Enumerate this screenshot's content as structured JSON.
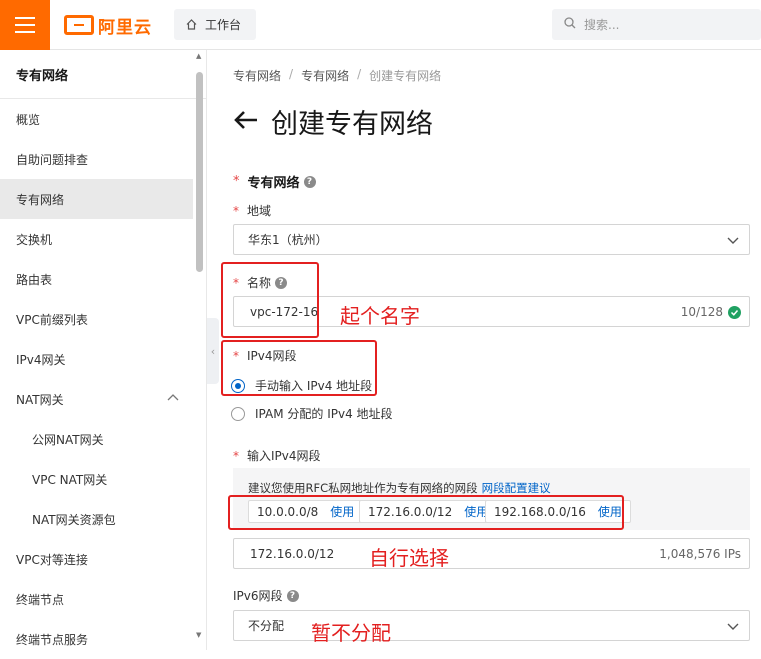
{
  "topbar": {
    "logo_text": "阿里云",
    "workbench_label": "工作台",
    "search_placeholder": "搜索..."
  },
  "sidebar": {
    "title": "专有网络",
    "items": [
      {
        "label": "概览"
      },
      {
        "label": "自助问题排查"
      },
      {
        "label": "专有网络",
        "active": true
      },
      {
        "label": "交换机"
      },
      {
        "label": "路由表"
      },
      {
        "label": "VPC前缀列表"
      },
      {
        "label": "IPv4网关"
      },
      {
        "label": "NAT网关",
        "expanded": true
      },
      {
        "label": "公网NAT网关",
        "sub": true
      },
      {
        "label": "VPC NAT网关",
        "sub": true
      },
      {
        "label": "NAT网关资源包",
        "sub": true
      },
      {
        "label": "VPC对等连接"
      },
      {
        "label": "终端节点"
      },
      {
        "label": "终端节点服务"
      }
    ]
  },
  "breadcrumb": [
    "专有网络",
    "专有网络",
    "创建专有网络"
  ],
  "breadcrumb_sep": "/",
  "page_title": "创建专有网络",
  "form": {
    "section_title": "专有网络",
    "required_mark": "*",
    "region": {
      "label": "地域",
      "value": "华东1（杭州）"
    },
    "name": {
      "label": "名称",
      "value": "vpc-172-16",
      "counter": "10/128"
    },
    "ipv4_segment": {
      "label": "IPv4网段",
      "options": [
        {
          "label": "手动输入 IPv4 地址段",
          "selected": true
        },
        {
          "label": "IPAM 分配的 IPv4 地址段",
          "selected": false
        }
      ]
    },
    "ipv4_input": {
      "label": "输入IPv4网段",
      "hint": "建议您使用RFC私网地址作为专有网络的网段",
      "hint_link": "网段配置建议",
      "cidrs": [
        {
          "cidr": "10.0.0.0/8",
          "action": "使用"
        },
        {
          "cidr": "172.16.0.0/12",
          "action": "使用"
        },
        {
          "cidr": "192.168.0.0/16",
          "action": "使用"
        }
      ],
      "value": "172.16.0.0/12",
      "ip_count": "1,048,576 IPs"
    },
    "ipv6": {
      "label": "IPv6网段",
      "value": "不分配"
    }
  },
  "annotations": {
    "name_note": "起个名字",
    "cidr_note": "自行选择",
    "ipv6_note": "暂不分配"
  },
  "colors": {
    "brand": "#ff6a00",
    "link": "#0064c8",
    "annotation": "#e32020",
    "success": "#20a162"
  }
}
